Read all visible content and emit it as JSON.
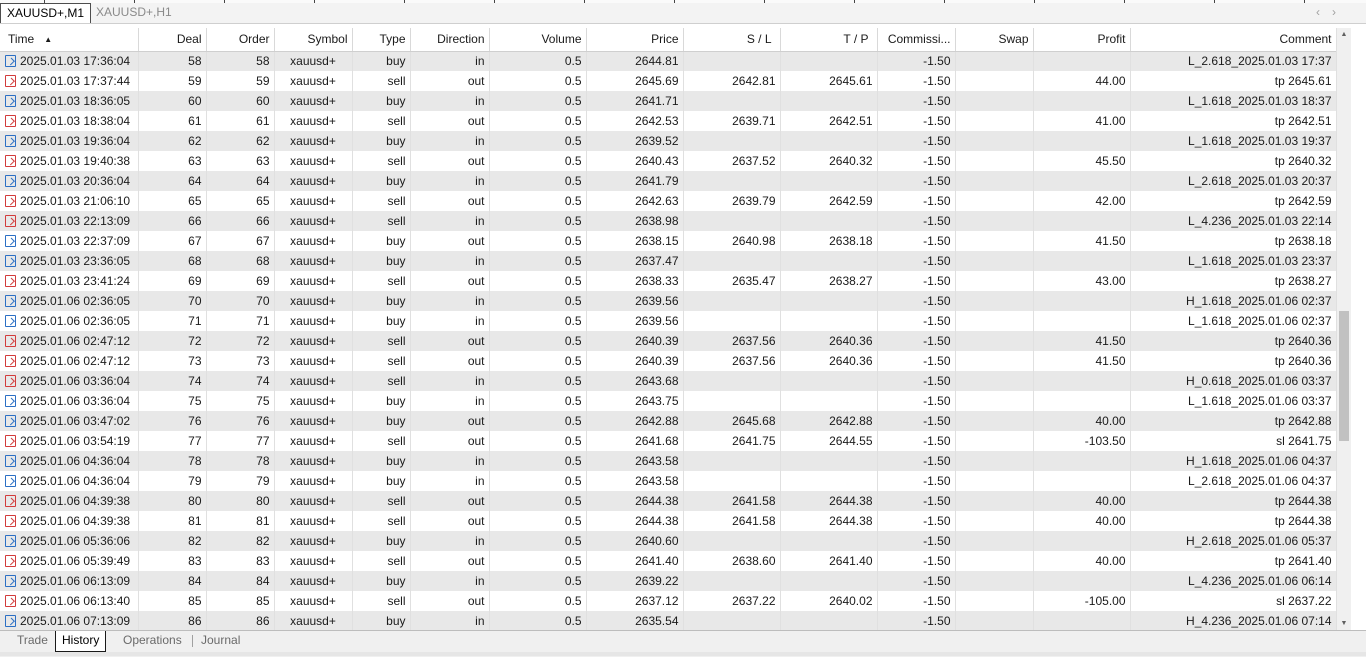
{
  "chart_tabs": [
    "XAUUSD+,M1",
    "XAUUSD+,H1"
  ],
  "nav": {
    "left": "‹",
    "right": "›"
  },
  "columns": [
    "Time",
    "Deal",
    "Order",
    "Symbol",
    "Type",
    "Direction",
    "Volume",
    "Price",
    "S / L",
    "T / P",
    "Commissi...",
    "Swap",
    "Profit",
    "Comment"
  ],
  "sort_indicator": "▲",
  "rows": [
    {
      "time": "2025.01.03 17:36:04",
      "deal": "58",
      "order": "58",
      "symbol": "xauusd+",
      "type": "buy",
      "direction": "in",
      "volume": "0.5",
      "price": "2644.81",
      "sl": "",
      "tp": "",
      "commission": "-1.50",
      "swap": "",
      "profit": "",
      "comment": "L_2.618_2025.01.03 17:37"
    },
    {
      "time": "2025.01.03 17:37:44",
      "deal": "59",
      "order": "59",
      "symbol": "xauusd+",
      "type": "sell",
      "direction": "out",
      "volume": "0.5",
      "price": "2645.69",
      "sl": "2642.81",
      "tp": "2645.61",
      "commission": "-1.50",
      "swap": "",
      "profit": "44.00",
      "comment": "tp 2645.61"
    },
    {
      "time": "2025.01.03 18:36:05",
      "deal": "60",
      "order": "60",
      "symbol": "xauusd+",
      "type": "buy",
      "direction": "in",
      "volume": "0.5",
      "price": "2641.71",
      "sl": "",
      "tp": "",
      "commission": "-1.50",
      "swap": "",
      "profit": "",
      "comment": "L_1.618_2025.01.03 18:37"
    },
    {
      "time": "2025.01.03 18:38:04",
      "deal": "61",
      "order": "61",
      "symbol": "xauusd+",
      "type": "sell",
      "direction": "out",
      "volume": "0.5",
      "price": "2642.53",
      "sl": "2639.71",
      "tp": "2642.51",
      "commission": "-1.50",
      "swap": "",
      "profit": "41.00",
      "comment": "tp 2642.51"
    },
    {
      "time": "2025.01.03 19:36:04",
      "deal": "62",
      "order": "62",
      "symbol": "xauusd+",
      "type": "buy",
      "direction": "in",
      "volume": "0.5",
      "price": "2639.52",
      "sl": "",
      "tp": "",
      "commission": "-1.50",
      "swap": "",
      "profit": "",
      "comment": "L_1.618_2025.01.03 19:37"
    },
    {
      "time": "2025.01.03 19:40:38",
      "deal": "63",
      "order": "63",
      "symbol": "xauusd+",
      "type": "sell",
      "direction": "out",
      "volume": "0.5",
      "price": "2640.43",
      "sl": "2637.52",
      "tp": "2640.32",
      "commission": "-1.50",
      "swap": "",
      "profit": "45.50",
      "comment": "tp 2640.32"
    },
    {
      "time": "2025.01.03 20:36:04",
      "deal": "64",
      "order": "64",
      "symbol": "xauusd+",
      "type": "buy",
      "direction": "in",
      "volume": "0.5",
      "price": "2641.79",
      "sl": "",
      "tp": "",
      "commission": "-1.50",
      "swap": "",
      "profit": "",
      "comment": "L_2.618_2025.01.03 20:37"
    },
    {
      "time": "2025.01.03 21:06:10",
      "deal": "65",
      "order": "65",
      "symbol": "xauusd+",
      "type": "sell",
      "direction": "out",
      "volume": "0.5",
      "price": "2642.63",
      "sl": "2639.79",
      "tp": "2642.59",
      "commission": "-1.50",
      "swap": "",
      "profit": "42.00",
      "comment": "tp 2642.59"
    },
    {
      "time": "2025.01.03 22:13:09",
      "deal": "66",
      "order": "66",
      "symbol": "xauusd+",
      "type": "sell",
      "direction": "in",
      "volume": "0.5",
      "price": "2638.98",
      "sl": "",
      "tp": "",
      "commission": "-1.50",
      "swap": "",
      "profit": "",
      "comment": "L_4.236_2025.01.03 22:14"
    },
    {
      "time": "2025.01.03 22:37:09",
      "deal": "67",
      "order": "67",
      "symbol": "xauusd+",
      "type": "buy",
      "direction": "out",
      "volume": "0.5",
      "price": "2638.15",
      "sl": "2640.98",
      "tp": "2638.18",
      "commission": "-1.50",
      "swap": "",
      "profit": "41.50",
      "comment": "tp 2638.18"
    },
    {
      "time": "2025.01.03 23:36:05",
      "deal": "68",
      "order": "68",
      "symbol": "xauusd+",
      "type": "buy",
      "direction": "in",
      "volume": "0.5",
      "price": "2637.47",
      "sl": "",
      "tp": "",
      "commission": "-1.50",
      "swap": "",
      "profit": "",
      "comment": "L_1.618_2025.01.03 23:37"
    },
    {
      "time": "2025.01.03 23:41:24",
      "deal": "69",
      "order": "69",
      "symbol": "xauusd+",
      "type": "sell",
      "direction": "out",
      "volume": "0.5",
      "price": "2638.33",
      "sl": "2635.47",
      "tp": "2638.27",
      "commission": "-1.50",
      "swap": "",
      "profit": "43.00",
      "comment": "tp 2638.27"
    },
    {
      "time": "2025.01.06 02:36:05",
      "deal": "70",
      "order": "70",
      "symbol": "xauusd+",
      "type": "buy",
      "direction": "in",
      "volume": "0.5",
      "price": "2639.56",
      "sl": "",
      "tp": "",
      "commission": "-1.50",
      "swap": "",
      "profit": "",
      "comment": "H_1.618_2025.01.06 02:37"
    },
    {
      "time": "2025.01.06 02:36:05",
      "deal": "71",
      "order": "71",
      "symbol": "xauusd+",
      "type": "buy",
      "direction": "in",
      "volume": "0.5",
      "price": "2639.56",
      "sl": "",
      "tp": "",
      "commission": "-1.50",
      "swap": "",
      "profit": "",
      "comment": "L_1.618_2025.01.06 02:37"
    },
    {
      "time": "2025.01.06 02:47:12",
      "deal": "72",
      "order": "72",
      "symbol": "xauusd+",
      "type": "sell",
      "direction": "out",
      "volume": "0.5",
      "price": "2640.39",
      "sl": "2637.56",
      "tp": "2640.36",
      "commission": "-1.50",
      "swap": "",
      "profit": "41.50",
      "comment": "tp 2640.36"
    },
    {
      "time": "2025.01.06 02:47:12",
      "deal": "73",
      "order": "73",
      "symbol": "xauusd+",
      "type": "sell",
      "direction": "out",
      "volume": "0.5",
      "price": "2640.39",
      "sl": "2637.56",
      "tp": "2640.36",
      "commission": "-1.50",
      "swap": "",
      "profit": "41.50",
      "comment": "tp 2640.36"
    },
    {
      "time": "2025.01.06 03:36:04",
      "deal": "74",
      "order": "74",
      "symbol": "xauusd+",
      "type": "sell",
      "direction": "in",
      "volume": "0.5",
      "price": "2643.68",
      "sl": "",
      "tp": "",
      "commission": "-1.50",
      "swap": "",
      "profit": "",
      "comment": "H_0.618_2025.01.06 03:37"
    },
    {
      "time": "2025.01.06 03:36:04",
      "deal": "75",
      "order": "75",
      "symbol": "xauusd+",
      "type": "buy",
      "direction": "in",
      "volume": "0.5",
      "price": "2643.75",
      "sl": "",
      "tp": "",
      "commission": "-1.50",
      "swap": "",
      "profit": "",
      "comment": "L_1.618_2025.01.06 03:37"
    },
    {
      "time": "2025.01.06 03:47:02",
      "deal": "76",
      "order": "76",
      "symbol": "xauusd+",
      "type": "buy",
      "direction": "out",
      "volume": "0.5",
      "price": "2642.88",
      "sl": "2645.68",
      "tp": "2642.88",
      "commission": "-1.50",
      "swap": "",
      "profit": "40.00",
      "comment": "tp 2642.88"
    },
    {
      "time": "2025.01.06 03:54:19",
      "deal": "77",
      "order": "77",
      "symbol": "xauusd+",
      "type": "sell",
      "direction": "out",
      "volume": "0.5",
      "price": "2641.68",
      "sl": "2641.75",
      "tp": "2644.55",
      "commission": "-1.50",
      "swap": "",
      "profit": "-103.50",
      "comment": "sl 2641.75"
    },
    {
      "time": "2025.01.06 04:36:04",
      "deal": "78",
      "order": "78",
      "symbol": "xauusd+",
      "type": "buy",
      "direction": "in",
      "volume": "0.5",
      "price": "2643.58",
      "sl": "",
      "tp": "",
      "commission": "-1.50",
      "swap": "",
      "profit": "",
      "comment": "H_1.618_2025.01.06 04:37"
    },
    {
      "time": "2025.01.06 04:36:04",
      "deal": "79",
      "order": "79",
      "symbol": "xauusd+",
      "type": "buy",
      "direction": "in",
      "volume": "0.5",
      "price": "2643.58",
      "sl": "",
      "tp": "",
      "commission": "-1.50",
      "swap": "",
      "profit": "",
      "comment": "L_2.618_2025.01.06 04:37"
    },
    {
      "time": "2025.01.06 04:39:38",
      "deal": "80",
      "order": "80",
      "symbol": "xauusd+",
      "type": "sell",
      "direction": "out",
      "volume": "0.5",
      "price": "2644.38",
      "sl": "2641.58",
      "tp": "2644.38",
      "commission": "-1.50",
      "swap": "",
      "profit": "40.00",
      "comment": "tp 2644.38"
    },
    {
      "time": "2025.01.06 04:39:38",
      "deal": "81",
      "order": "81",
      "symbol": "xauusd+",
      "type": "sell",
      "direction": "out",
      "volume": "0.5",
      "price": "2644.38",
      "sl": "2641.58",
      "tp": "2644.38",
      "commission": "-1.50",
      "swap": "",
      "profit": "40.00",
      "comment": "tp 2644.38"
    },
    {
      "time": "2025.01.06 05:36:06",
      "deal": "82",
      "order": "82",
      "symbol": "xauusd+",
      "type": "buy",
      "direction": "in",
      "volume": "0.5",
      "price": "2640.60",
      "sl": "",
      "tp": "",
      "commission": "-1.50",
      "swap": "",
      "profit": "",
      "comment": "H_2.618_2025.01.06 05:37"
    },
    {
      "time": "2025.01.06 05:39:49",
      "deal": "83",
      "order": "83",
      "symbol": "xauusd+",
      "type": "sell",
      "direction": "out",
      "volume": "0.5",
      "price": "2641.40",
      "sl": "2638.60",
      "tp": "2641.40",
      "commission": "-1.50",
      "swap": "",
      "profit": "40.00",
      "comment": "tp 2641.40"
    },
    {
      "time": "2025.01.06 06:13:09",
      "deal": "84",
      "order": "84",
      "symbol": "xauusd+",
      "type": "buy",
      "direction": "in",
      "volume": "0.5",
      "price": "2639.22",
      "sl": "",
      "tp": "",
      "commission": "-1.50",
      "swap": "",
      "profit": "",
      "comment": "L_4.236_2025.01.06 06:14"
    },
    {
      "time": "2025.01.06 06:13:40",
      "deal": "85",
      "order": "85",
      "symbol": "xauusd+",
      "type": "sell",
      "direction": "out",
      "volume": "0.5",
      "price": "2637.12",
      "sl": "2637.22",
      "tp": "2640.02",
      "commission": "-1.50",
      "swap": "",
      "profit": "-105.00",
      "comment": "sl 2637.22"
    },
    {
      "time": "2025.01.06 07:13:09",
      "deal": "86",
      "order": "86",
      "symbol": "xauusd+",
      "type": "buy",
      "direction": "in",
      "volume": "0.5",
      "price": "2635.54",
      "sl": "",
      "tp": "",
      "commission": "-1.50",
      "swap": "",
      "profit": "",
      "comment": "H_4.236_2025.01.06 07:14"
    }
  ],
  "bottom_tabs": [
    "Trade",
    "History",
    "Operations",
    "Journal"
  ],
  "active_bottom_tab": "History",
  "colors": {
    "buy_icon": "#2b6fc4",
    "sell_icon": "#d23b3b",
    "row_stripe": "#e8e8e8"
  },
  "icons": {
    "buy_row": "buy-deal-icon",
    "sell_row": "sell-deal-icon"
  }
}
